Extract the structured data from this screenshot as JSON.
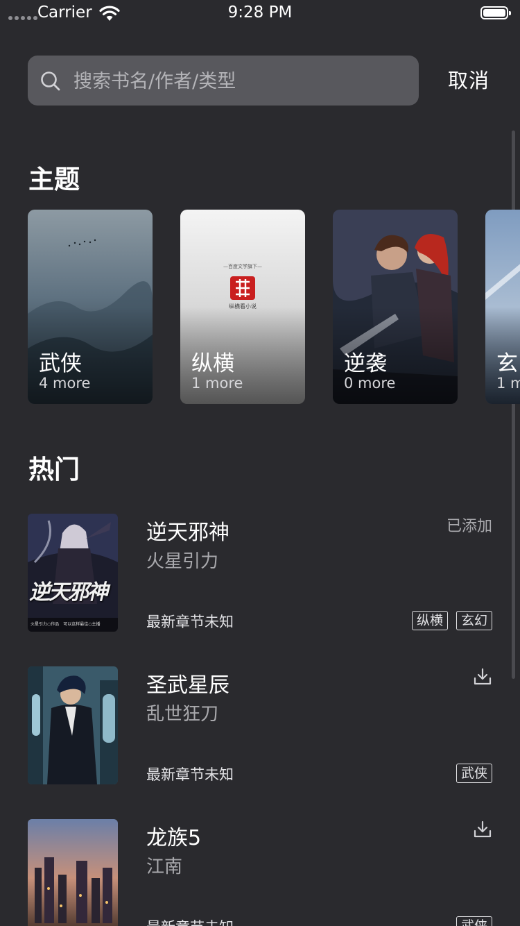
{
  "status_bar": {
    "carrier": "Carrier",
    "time": "9:28 PM"
  },
  "search": {
    "placeholder": "搜索书名/作者/类型",
    "value": "",
    "cancel_label": "取消"
  },
  "topics": {
    "title": "主题",
    "items": [
      {
        "name": "武侠",
        "count": "4 more"
      },
      {
        "name": "纵横",
        "count": "1 more",
        "cover_caption": "—百度文学旗下—",
        "cover_logo_text": "纵横看小说"
      },
      {
        "name": "逆袭",
        "count": "0 more"
      },
      {
        "name": "玄",
        "count": "1 m"
      }
    ]
  },
  "hot": {
    "title": "热门",
    "books": [
      {
        "title": "逆天邪神",
        "author": "火星引力",
        "chapter": "最新章节未知",
        "status": "已添加",
        "tags": [
          "纵横",
          "玄幻"
        ],
        "cover_text": "逆天邪神",
        "cover_caption": "火星引力○作品　可以这样最佳○主播"
      },
      {
        "title": "圣武星辰",
        "author": "乱世狂刀",
        "chapter": "最新章节未知",
        "tags": [
          "武侠"
        ]
      },
      {
        "title": "龙族5",
        "author": "江南",
        "chapter": "最新章节未知",
        "tags": [
          "武侠"
        ]
      }
    ]
  }
}
